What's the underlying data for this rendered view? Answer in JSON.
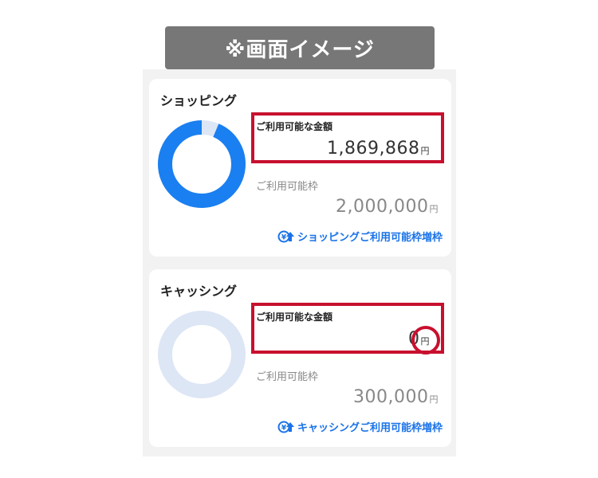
{
  "banner": {
    "text": "※画面イメージ"
  },
  "shopping": {
    "title": "ショッピング",
    "available_label": "ご利用可能な金額",
    "available_value": "1,869,868",
    "currency": "円",
    "limit_label": "ご利用可能枠",
    "limit_value": "2,000,000",
    "increase_link": "ショッピングご利用可能枠増枠",
    "available_ratio": 0.935
  },
  "cashing": {
    "title": "キャッシング",
    "available_label": "ご利用可能な金額",
    "available_value": "0",
    "currency": "円",
    "limit_label": "ご利用可能枠",
    "limit_value": "300,000",
    "increase_link": "キャッシングご利用可能枠増枠",
    "available_ratio": 0
  },
  "colors": {
    "accent": "#1a73e8",
    "donut_fill": "#1a7ff0",
    "donut_track": "#dde6f5",
    "highlight": "#c8102e"
  },
  "icons": {
    "increase": "credit-card-up-arrow-icon"
  }
}
